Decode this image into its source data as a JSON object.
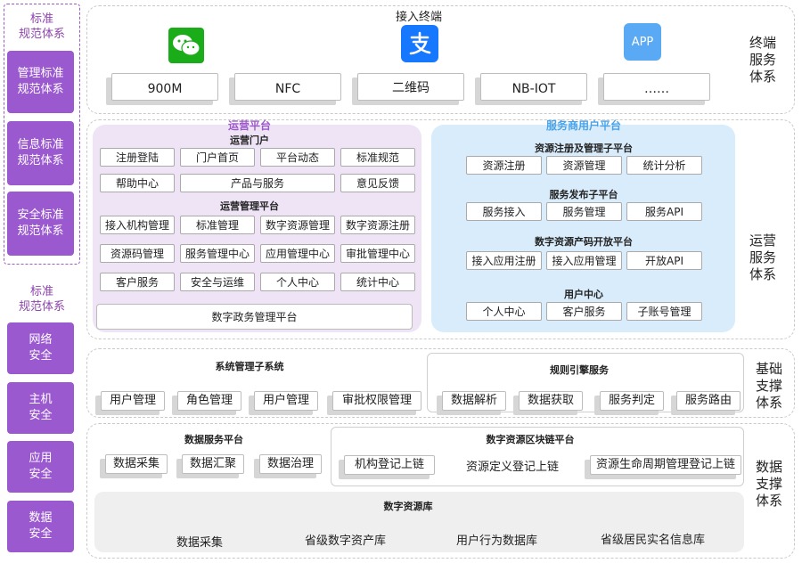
{
  "left_column": {
    "standard_title_1": "标准\n规范体系",
    "standard_blocks": [
      "管理标准\n规范体系",
      "信息标准\n规范体系",
      "安全标准\n规范体系"
    ],
    "standard_title_2": "标准\n规范体系",
    "security_blocks": [
      "网络\n安全",
      "主机\n安全",
      "应用\n安全",
      "数据\n安全"
    ]
  },
  "terminal": {
    "title": "接入终端",
    "app_icon_text": "APP",
    "items": [
      "900M",
      "NFC",
      "二维码",
      "NB-IOT",
      "……"
    ],
    "side_label": "终端\n服务\n体系"
  },
  "operation": {
    "side_label": "运营\n服务\n体系",
    "platform_title": "运营平台",
    "portal_title": "运营门户",
    "portal_row1": [
      "注册登陆",
      "门户首页",
      "平台动态",
      "标准规范"
    ],
    "portal_row2": [
      "帮助中心",
      "产品与服务",
      "意见反馈"
    ],
    "mgmt_title": "运营管理平台",
    "mgmt_row1": [
      "接入机构管理",
      "标准管理",
      "数字资源管理",
      "数字资源注册"
    ],
    "mgmt_row2": [
      "资源码管理",
      "服务管理中心",
      "应用管理中心",
      "审批管理中心"
    ],
    "mgmt_row3": [
      "客户服务",
      "安全与运维",
      "个人中心",
      "统计中心"
    ],
    "gov_platform": "数字政务管理平台",
    "provider_title": "服务商用户平台",
    "res_reg_title": "资源注册及管理子平台",
    "res_reg_items": [
      "资源注册",
      "资源管理",
      "统计分析"
    ],
    "svc_pub_title": "服务发布子平台",
    "svc_pub_items": [
      "服务接入",
      "服务管理",
      "服务API"
    ],
    "code_open_title": "数字资源产码开放平台",
    "code_open_items": [
      "接入应用注册",
      "接入应用管理",
      "开放API"
    ],
    "user_center_title": "用户中心",
    "user_center_items": [
      "个人中心",
      "客户服务",
      "子账号管理"
    ]
  },
  "basic": {
    "side_label": "基础\n支撑\n体系",
    "sys_mgmt_title": "系统管理子系统",
    "sys_mgmt_items": [
      "用户管理",
      "角色管理",
      "用户管理",
      "审批权限管理"
    ],
    "rule_title": "规则引擎服务",
    "rule_items": [
      "数据解析",
      "数据获取",
      "服务判定",
      "服务路由"
    ]
  },
  "data": {
    "side_label": "数据\n支撑\n体系",
    "data_svc_title": "数据服务平台",
    "data_svc_items": [
      "数据采集",
      "数据汇聚",
      "数据治理"
    ],
    "chain_title": "数字资源区块链平台",
    "chain_items": [
      "机构登记上链",
      "资源定义登记上链",
      "资源生命周期管理登记上链"
    ],
    "repo_title": "数字资源库",
    "repo_items": [
      "数据采集",
      "省级数字资产库",
      "用户行为数据库",
      "省级居民实名信息库"
    ]
  },
  "colors": {
    "purple": "#9b59d0",
    "wechat_green": "#1aad19",
    "alipay_blue": "#1677ff",
    "app_blue": "#5aa9f5"
  }
}
